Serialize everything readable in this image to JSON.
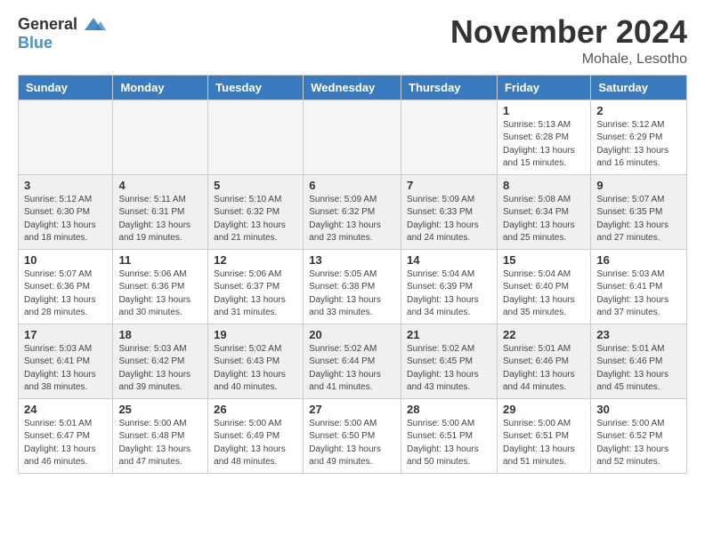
{
  "header": {
    "logo_general": "General",
    "logo_blue": "Blue",
    "month": "November 2024",
    "location": "Mohale, Lesotho"
  },
  "days_of_week": [
    "Sunday",
    "Monday",
    "Tuesday",
    "Wednesday",
    "Thursday",
    "Friday",
    "Saturday"
  ],
  "weeks": [
    [
      {
        "day": "",
        "info": ""
      },
      {
        "day": "",
        "info": ""
      },
      {
        "day": "",
        "info": ""
      },
      {
        "day": "",
        "info": ""
      },
      {
        "day": "",
        "info": ""
      },
      {
        "day": "1",
        "info": "Sunrise: 5:13 AM\nSunset: 6:28 PM\nDaylight: 13 hours\nand 15 minutes."
      },
      {
        "day": "2",
        "info": "Sunrise: 5:12 AM\nSunset: 6:29 PM\nDaylight: 13 hours\nand 16 minutes."
      }
    ],
    [
      {
        "day": "3",
        "info": "Sunrise: 5:12 AM\nSunset: 6:30 PM\nDaylight: 13 hours\nand 18 minutes."
      },
      {
        "day": "4",
        "info": "Sunrise: 5:11 AM\nSunset: 6:31 PM\nDaylight: 13 hours\nand 19 minutes."
      },
      {
        "day": "5",
        "info": "Sunrise: 5:10 AM\nSunset: 6:32 PM\nDaylight: 13 hours\nand 21 minutes."
      },
      {
        "day": "6",
        "info": "Sunrise: 5:09 AM\nSunset: 6:32 PM\nDaylight: 13 hours\nand 23 minutes."
      },
      {
        "day": "7",
        "info": "Sunrise: 5:09 AM\nSunset: 6:33 PM\nDaylight: 13 hours\nand 24 minutes."
      },
      {
        "day": "8",
        "info": "Sunrise: 5:08 AM\nSunset: 6:34 PM\nDaylight: 13 hours\nand 25 minutes."
      },
      {
        "day": "9",
        "info": "Sunrise: 5:07 AM\nSunset: 6:35 PM\nDaylight: 13 hours\nand 27 minutes."
      }
    ],
    [
      {
        "day": "10",
        "info": "Sunrise: 5:07 AM\nSunset: 6:36 PM\nDaylight: 13 hours\nand 28 minutes."
      },
      {
        "day": "11",
        "info": "Sunrise: 5:06 AM\nSunset: 6:36 PM\nDaylight: 13 hours\nand 30 minutes."
      },
      {
        "day": "12",
        "info": "Sunrise: 5:06 AM\nSunset: 6:37 PM\nDaylight: 13 hours\nand 31 minutes."
      },
      {
        "day": "13",
        "info": "Sunrise: 5:05 AM\nSunset: 6:38 PM\nDaylight: 13 hours\nand 33 minutes."
      },
      {
        "day": "14",
        "info": "Sunrise: 5:04 AM\nSunset: 6:39 PM\nDaylight: 13 hours\nand 34 minutes."
      },
      {
        "day": "15",
        "info": "Sunrise: 5:04 AM\nSunset: 6:40 PM\nDaylight: 13 hours\nand 35 minutes."
      },
      {
        "day": "16",
        "info": "Sunrise: 5:03 AM\nSunset: 6:41 PM\nDaylight: 13 hours\nand 37 minutes."
      }
    ],
    [
      {
        "day": "17",
        "info": "Sunrise: 5:03 AM\nSunset: 6:41 PM\nDaylight: 13 hours\nand 38 minutes."
      },
      {
        "day": "18",
        "info": "Sunrise: 5:03 AM\nSunset: 6:42 PM\nDaylight: 13 hours\nand 39 minutes."
      },
      {
        "day": "19",
        "info": "Sunrise: 5:02 AM\nSunset: 6:43 PM\nDaylight: 13 hours\nand 40 minutes."
      },
      {
        "day": "20",
        "info": "Sunrise: 5:02 AM\nSunset: 6:44 PM\nDaylight: 13 hours\nand 41 minutes."
      },
      {
        "day": "21",
        "info": "Sunrise: 5:02 AM\nSunset: 6:45 PM\nDaylight: 13 hours\nand 43 minutes."
      },
      {
        "day": "22",
        "info": "Sunrise: 5:01 AM\nSunset: 6:46 PM\nDaylight: 13 hours\nand 44 minutes."
      },
      {
        "day": "23",
        "info": "Sunrise: 5:01 AM\nSunset: 6:46 PM\nDaylight: 13 hours\nand 45 minutes."
      }
    ],
    [
      {
        "day": "24",
        "info": "Sunrise: 5:01 AM\nSunset: 6:47 PM\nDaylight: 13 hours\nand 46 minutes."
      },
      {
        "day": "25",
        "info": "Sunrise: 5:00 AM\nSunset: 6:48 PM\nDaylight: 13 hours\nand 47 minutes."
      },
      {
        "day": "26",
        "info": "Sunrise: 5:00 AM\nSunset: 6:49 PM\nDaylight: 13 hours\nand 48 minutes."
      },
      {
        "day": "27",
        "info": "Sunrise: 5:00 AM\nSunset: 6:50 PM\nDaylight: 13 hours\nand 49 minutes."
      },
      {
        "day": "28",
        "info": "Sunrise: 5:00 AM\nSunset: 6:51 PM\nDaylight: 13 hours\nand 50 minutes."
      },
      {
        "day": "29",
        "info": "Sunrise: 5:00 AM\nSunset: 6:51 PM\nDaylight: 13 hours\nand 51 minutes."
      },
      {
        "day": "30",
        "info": "Sunrise: 5:00 AM\nSunset: 6:52 PM\nDaylight: 13 hours\nand 52 minutes."
      }
    ]
  ]
}
